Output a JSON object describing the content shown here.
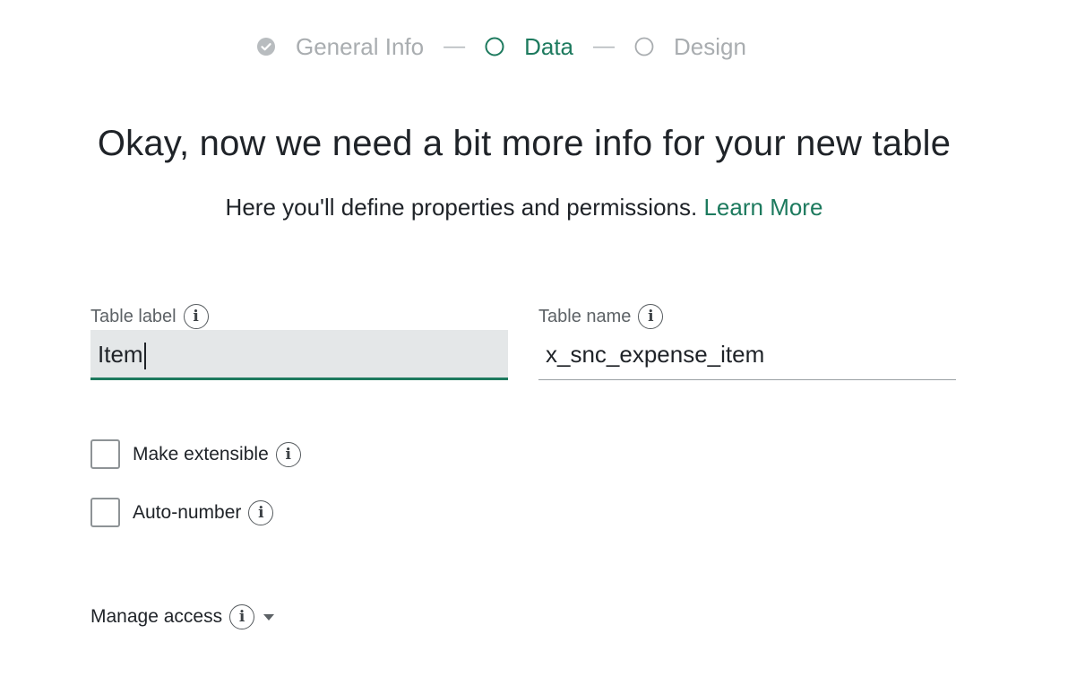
{
  "stepper": {
    "steps": [
      {
        "label": "General Info",
        "state": "complete",
        "icon": "check-circle-icon"
      },
      {
        "label": "Data",
        "state": "active",
        "icon": "circle-outline-icon"
      },
      {
        "label": "Design",
        "state": "pending",
        "icon": "circle-outline-icon"
      }
    ],
    "separator": "—"
  },
  "heading": "Okay, now we need a bit more info for your new table",
  "subheading": {
    "text": "Here you'll define properties and permissions.",
    "link": "Learn More"
  },
  "fields": {
    "table_label": {
      "label": "Table label",
      "value": "Item",
      "info_icon": "info-icon"
    },
    "table_name": {
      "label": "Table name",
      "value": "x_snc_expense_item",
      "info_icon": "info-icon"
    }
  },
  "checkboxes": [
    {
      "label": "Make extensible",
      "checked": false
    },
    {
      "label": "Auto-number",
      "checked": false
    }
  ],
  "manage_access": {
    "label": "Manage access"
  },
  "info_glyph": "i",
  "colors": {
    "accent": "#1d7a5e",
    "muted": "#a9adb0",
    "text": "#1f2328",
    "input_bg": "#e4e7e8"
  }
}
